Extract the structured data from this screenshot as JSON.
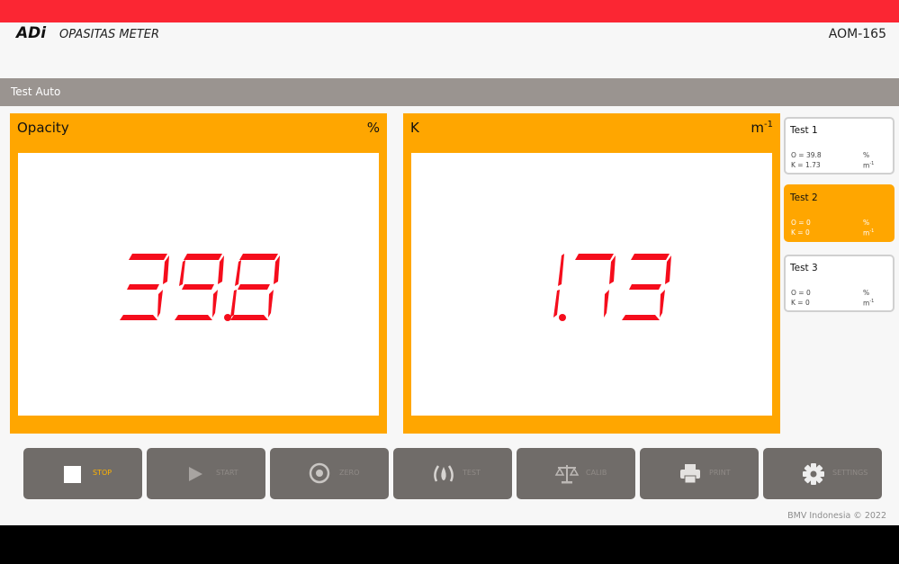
{
  "header": {
    "logo": "ADi",
    "app_name": "OPASITAS METER",
    "model": "AOM-165"
  },
  "mode": {
    "label": "Test Auto"
  },
  "panels": [
    {
      "title": "Opacity",
      "unit": "%",
      "value": "39.8"
    },
    {
      "title": "K",
      "unit": "m",
      "unit_sup": "-1",
      "value": "1.73"
    }
  ],
  "tests": [
    {
      "label": "Test 1",
      "o_line": "O  =  39.8",
      "o_unit": "%",
      "k_line": "K  =  1.73",
      "k_unit": "m",
      "k_sup": "-1",
      "active": false
    },
    {
      "label": "Test 2",
      "o_line": "O  =  0",
      "o_unit": "%",
      "k_line": "K  =  0",
      "k_unit": "m",
      "k_sup": "-1",
      "active": true
    },
    {
      "label": "Test 3",
      "o_line": "O  =  0",
      "o_unit": "%",
      "k_line": "K  =  0",
      "k_unit": "m",
      "k_sup": "-1",
      "active": false
    }
  ],
  "buttons": [
    {
      "label": "STOP",
      "icon": "stop-icon"
    },
    {
      "label": "START",
      "icon": "play-icon"
    },
    {
      "label": "ZERO",
      "icon": "target-icon"
    },
    {
      "label": "TEST",
      "icon": "smoke-icon"
    },
    {
      "label": "CALIB",
      "icon": "scale-icon"
    },
    {
      "label": "PRINT",
      "icon": "printer-icon"
    },
    {
      "label": "SETTINGS",
      "icon": "gear-icon"
    }
  ],
  "footer": {
    "copyright": "BMV Indonesia © 2022"
  },
  "colors": {
    "accent": "#ffa600",
    "topbar": "#fb2633",
    "digit": "#f50d1c",
    "button": "#706c69",
    "button_label": "#ffb300"
  }
}
